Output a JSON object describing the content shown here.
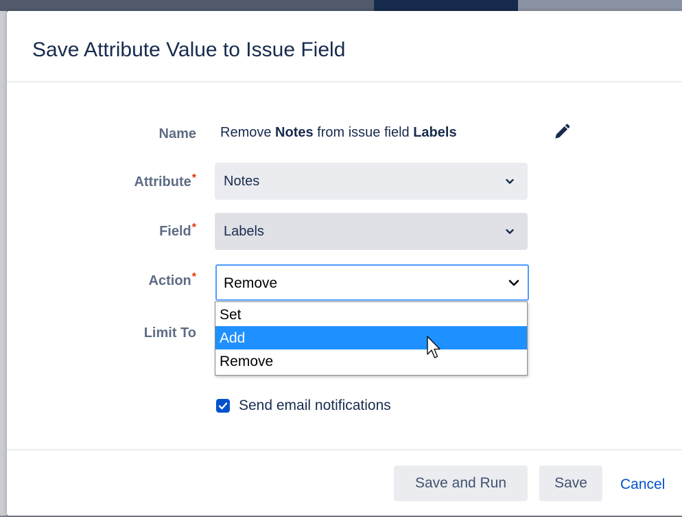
{
  "dialog": {
    "title": "Save Attribute Value to Issue Field"
  },
  "form": {
    "name_label": "Name",
    "name_value": {
      "prefix": "Remove ",
      "attribute": "Notes",
      "middle": " from issue field ",
      "field": "Labels"
    },
    "attribute_label": "Attribute",
    "attribute_value": "Notes",
    "field_label": "Field",
    "field_value": "Labels",
    "action_label": "Action",
    "action_value": "Remove",
    "action_options": [
      "Set",
      "Add",
      "Remove"
    ],
    "highlighted_option": "Add",
    "limit_to_label": "Limit To",
    "required_marker": "*",
    "send_email_label": "Send email notifications",
    "send_email_checked": true
  },
  "footer": {
    "save_and_run_label": "Save and Run",
    "save_label": "Save",
    "cancel_label": "Cancel"
  },
  "colors": {
    "primary": "#0052cc",
    "text": "#172b4d",
    "label": "#5e6c84",
    "required": "#de350b",
    "focus_border": "#4c9aff",
    "highlight": "#1e90ff"
  },
  "icons": {
    "edit": "pencil-icon",
    "select": "chevron-down-icon",
    "checkbox": "checkmark-icon",
    "pointer": "mouse-cursor-icon"
  }
}
